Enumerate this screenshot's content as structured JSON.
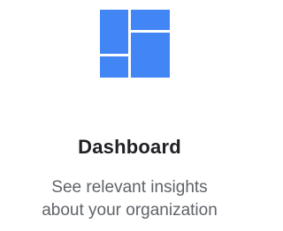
{
  "card": {
    "icon": "dashboard-icon",
    "accent_color": "#4285F4",
    "title": "Dashboard",
    "description_line1": "See relevant insights",
    "description_line2": "about your organization"
  }
}
